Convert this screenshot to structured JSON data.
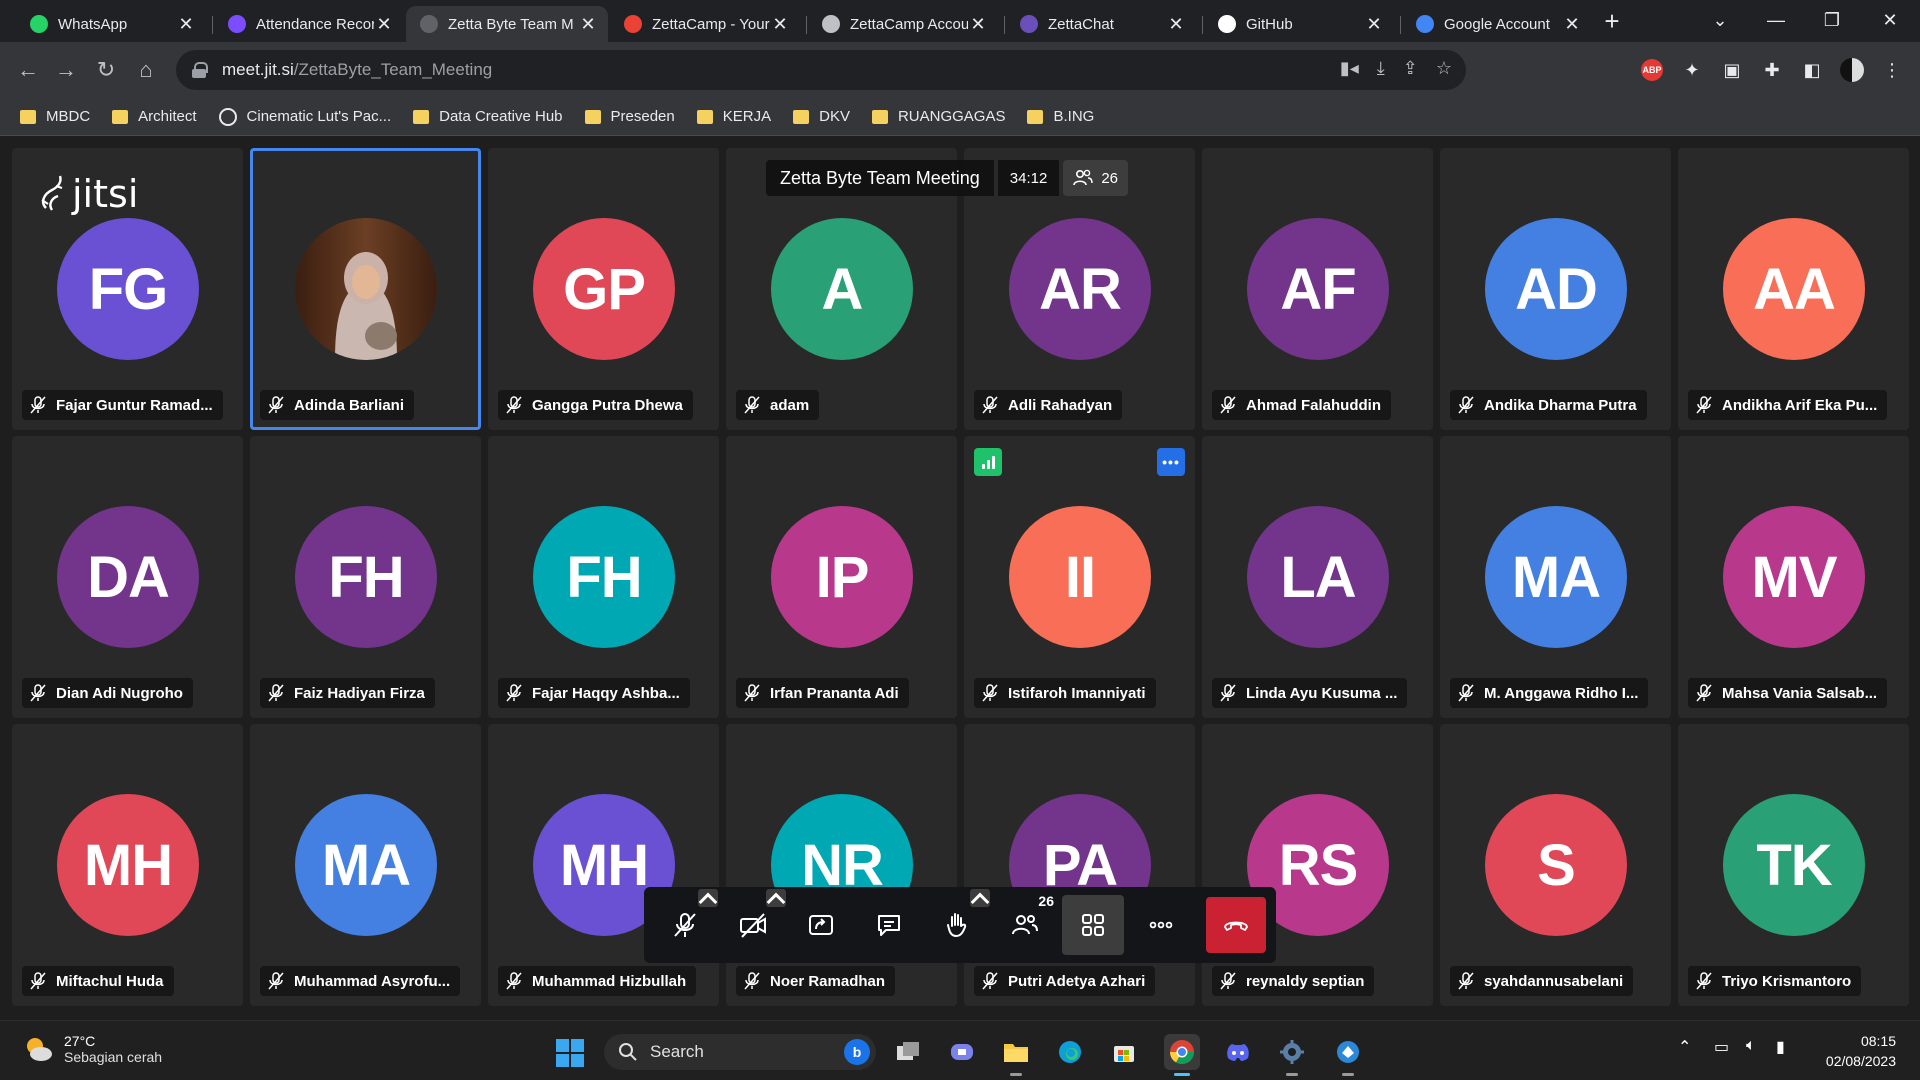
{
  "browser": {
    "tabs": [
      {
        "title": "WhatsApp",
        "icon": "whatsapp-icon",
        "color": "#25d366"
      },
      {
        "title": "Attendance Recor",
        "icon": "forms-icon",
        "color": "#7c4dff"
      },
      {
        "title": "Zetta Byte Team M",
        "icon": "jitsi-icon",
        "color": "#5f6368",
        "active": true
      },
      {
        "title": "ZettaCamp - Your",
        "icon": "gmail-icon",
        "color": "#ea4335"
      },
      {
        "title": "ZettaCamp Accou",
        "icon": "globe-icon",
        "color": "#bdc1c6"
      },
      {
        "title": "ZettaChat",
        "icon": "zettachat-icon",
        "color": "#6b4fbb"
      },
      {
        "title": "GitHub",
        "icon": "github-icon",
        "color": "#ffffff"
      },
      {
        "title": "Google Account",
        "icon": "google-icon",
        "color": "#4285f4"
      }
    ],
    "url_host": "meet.jit.si",
    "url_path": "/ZettaByte_Team_Meeting",
    "bookmarks": [
      {
        "label": "MBDC",
        "type": "folder"
      },
      {
        "label": "Architect",
        "type": "folder"
      },
      {
        "label": "Cinematic Lut's Pac...",
        "type": "site"
      },
      {
        "label": "Data Creative Hub",
        "type": "folder"
      },
      {
        "label": "Preseden",
        "type": "folder"
      },
      {
        "label": "KERJA",
        "type": "folder"
      },
      {
        "label": "DKV",
        "type": "folder"
      },
      {
        "label": "RUANGGAGAS",
        "type": "folder"
      },
      {
        "label": "B.ING",
        "type": "folder"
      }
    ]
  },
  "meeting": {
    "logo_text": "jitsi",
    "subject": "Zetta Byte Team Meeting",
    "duration": "34:12",
    "participant_count": "26",
    "participants": [
      {
        "initials": "FG",
        "name": "Fajar Guntur Ramad...",
        "color": "#6a50d3"
      },
      {
        "initials": "",
        "name": "Adinda Barliani",
        "color": "#3b2416",
        "photo": true,
        "dominant": true
      },
      {
        "initials": "GP",
        "name": "Gangga Putra Dhewa",
        "color": "#e04757"
      },
      {
        "initials": "A",
        "name": "adam",
        "color": "#2aa076"
      },
      {
        "initials": "AR",
        "name": "Adli Rahadyan",
        "color": "#73348c"
      },
      {
        "initials": "AF",
        "name": "Ahmad Falahuddin",
        "color": "#73348c"
      },
      {
        "initials": "AD",
        "name": "Andika Dharma Putra",
        "color": "#4380e2"
      },
      {
        "initials": "AA",
        "name": "Andikha Arif Eka Pu...",
        "color": "#f96e57"
      },
      {
        "initials": "DA",
        "name": "Dian Adi Nugroho",
        "color": "#73348c"
      },
      {
        "initials": "FH",
        "name": "Faiz Hadiyan Firza",
        "color": "#73348c"
      },
      {
        "initials": "FH",
        "name": "Fajar Haqqy Ashba...",
        "color": "#00a8b3"
      },
      {
        "initials": "IP",
        "name": "Irfan Prananta Adi",
        "color": "#b8398c"
      },
      {
        "initials": "II",
        "name": "Istifaroh Imanniyati",
        "color": "#f96e57",
        "indicators": true
      },
      {
        "initials": "LA",
        "name": "Linda Ayu Kusuma ...",
        "color": "#73348c"
      },
      {
        "initials": "MA",
        "name": "M. Anggawa Ridho I...",
        "color": "#4380e2"
      },
      {
        "initials": "MV",
        "name": "Mahsa Vania Salsab...",
        "color": "#b8398c"
      },
      {
        "initials": "MH",
        "name": "Miftachul Huda",
        "color": "#e04757"
      },
      {
        "initials": "MA",
        "name": "Muhammad Asyrofu...",
        "color": "#4380e2"
      },
      {
        "initials": "MH",
        "name": "Muhammad Hizbullah",
        "color": "#6a50d3"
      },
      {
        "initials": "NR",
        "name": "Noer Ramadhan",
        "color": "#00a8b3"
      },
      {
        "initials": "PA",
        "name": "Putri Adetya Azhari",
        "color": "#73348c"
      },
      {
        "initials": "RS",
        "name": "reynaldy septian",
        "color": "#b8398c"
      },
      {
        "initials": "S",
        "name": "syahdannusabelani",
        "color": "#e04757"
      },
      {
        "initials": "TK",
        "name": "Triyo Krismantoro",
        "color": "#2aa076"
      }
    ],
    "toolbox": {
      "participants_badge": "26",
      "buttons": [
        "microphone",
        "camera",
        "share-screen",
        "chat",
        "raise-hand",
        "participants",
        "tile-view",
        "more",
        "hangup"
      ]
    }
  },
  "taskbar": {
    "temperature": "27°C",
    "weather": "Sebagian cerah",
    "search_label": "Search",
    "time": "08:15",
    "date": "02/08/2023"
  }
}
